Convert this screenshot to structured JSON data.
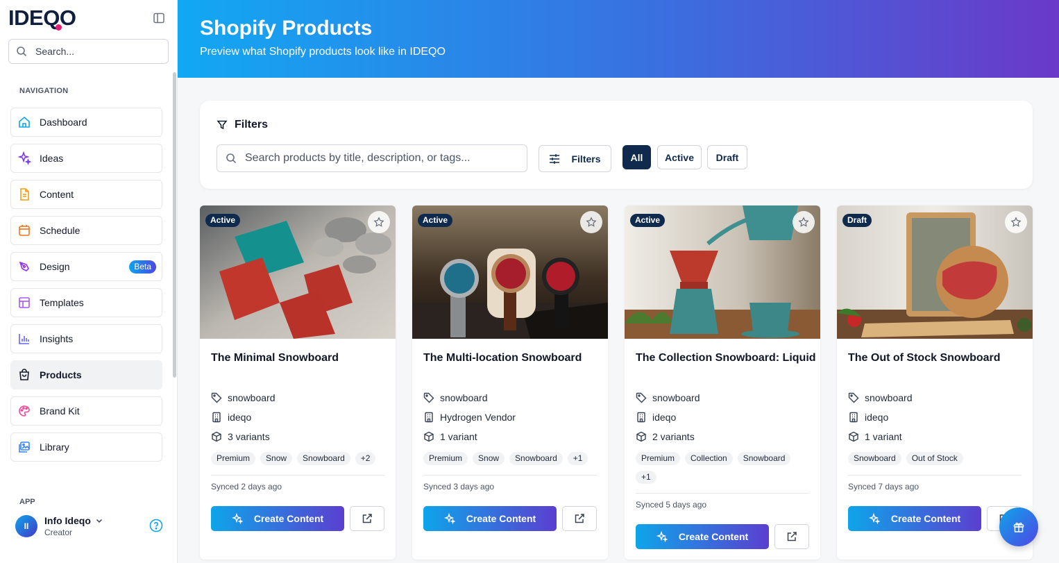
{
  "app": {
    "logo": "IDEQO"
  },
  "sidebar": {
    "search_placeholder": "Search...",
    "nav_title": "NAVIGATION",
    "items": [
      {
        "label": "Dashboard",
        "icon": "home-icon"
      },
      {
        "label": "Ideas",
        "icon": "sparkles-icon"
      },
      {
        "label": "Content",
        "icon": "document-icon"
      },
      {
        "label": "Schedule",
        "icon": "calendar-icon"
      },
      {
        "label": "Design",
        "icon": "pen-tool-icon",
        "badge": "Beta"
      },
      {
        "label": "Templates",
        "icon": "layout-icon"
      },
      {
        "label": "Insights",
        "icon": "bar-chart-icon"
      },
      {
        "label": "Products",
        "icon": "shopping-bag-icon",
        "active": true
      },
      {
        "label": "Brand Kit",
        "icon": "palette-icon"
      },
      {
        "label": "Library",
        "icon": "image-library-icon"
      }
    ],
    "app_title": "APP",
    "user": {
      "name": "Info Ideqo",
      "role": "Creator",
      "initials": "II"
    }
  },
  "header": {
    "title": "Shopify Products",
    "subtitle": "Preview what Shopify products look like in IDEQO"
  },
  "filters": {
    "title": "Filters",
    "search_placeholder": "Search products by title, description, or tags...",
    "filters_button": "Filters",
    "segments": [
      "All",
      "Active",
      "Draft"
    ],
    "selected_segment": "All"
  },
  "products": [
    {
      "status": "Active",
      "title": "The Minimal Snowboard",
      "type": "snowboard",
      "vendor": "ideqo",
      "variants": "3 variants",
      "tags": [
        "Premium",
        "Snow",
        "Snowboard",
        "+2"
      ],
      "synced": "Synced 2 days ago",
      "create_label": "Create Content"
    },
    {
      "status": "Active",
      "title": "The Multi-location Snowboard",
      "type": "snowboard",
      "vendor": "Hydrogen Vendor",
      "variants": "1 variant",
      "tags": [
        "Premium",
        "Snow",
        "Snowboard",
        "+1"
      ],
      "synced": "Synced 3 days ago",
      "create_label": "Create Content"
    },
    {
      "status": "Active",
      "title": "The Collection Snowboard: Liquid",
      "type": "snowboard",
      "vendor": "ideqo",
      "variants": "2 variants",
      "tags": [
        "Premium",
        "Collection",
        "Snowboard",
        "+1"
      ],
      "synced": "Synced 5 days ago",
      "create_label": "Create Content"
    },
    {
      "status": "Draft",
      "title": "The Out of Stock Snowboard",
      "type": "snowboard",
      "vendor": "ideqo",
      "variants": "1 variant",
      "tags": [
        "Snowboard",
        "Out of Stock"
      ],
      "synced": "Synced 7 days ago",
      "create_label": "Create Content"
    }
  ],
  "colors": {
    "accent": "#0f2a4d",
    "gradient_start": "#12a8f3",
    "gradient_end": "#6a39c9"
  }
}
